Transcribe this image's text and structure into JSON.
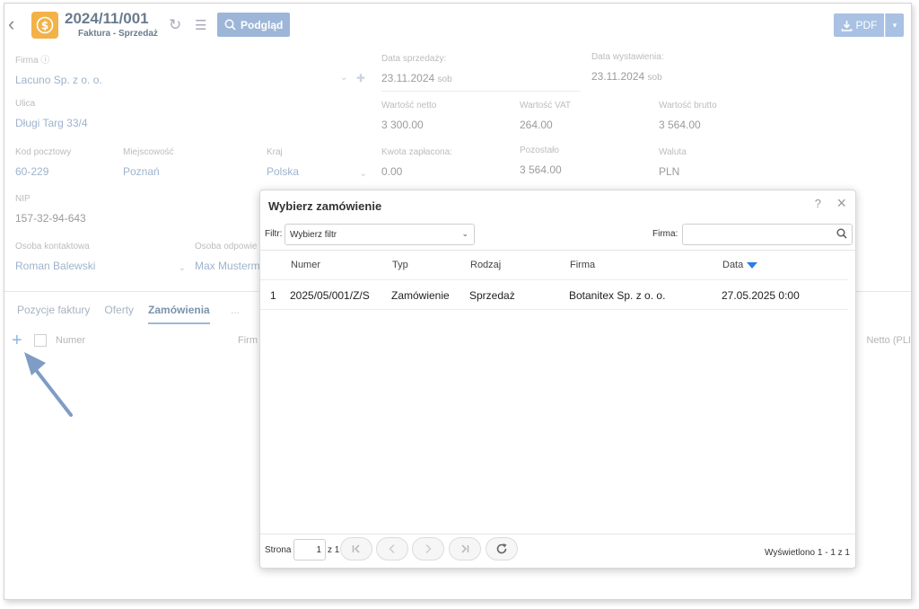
{
  "header": {
    "doc_number": "2024/11/001",
    "doc_subtitle": "Faktura - Sprzedaż",
    "preview_label": "Podgląd",
    "pdf_label": "PDF"
  },
  "form": {
    "firma": {
      "label": "Firma",
      "value": "Lacuno Sp. z o. o."
    },
    "data_sprzedazy": {
      "label": "Data sprzedaży:",
      "value": "23.11.2024",
      "day": "sob"
    },
    "data_wystawienia": {
      "label": "Data wystawienia:",
      "value": "23.11.2024",
      "day": "sob"
    },
    "ulica": {
      "label": "Ulica",
      "value": "Długi Targ 33/4"
    },
    "wartosc_netto": {
      "label": "Wartość netto",
      "value": "3 300.00"
    },
    "wartosc_vat": {
      "label": "Wartość VAT",
      "value": "264.00"
    },
    "wartosc_brutto": {
      "label": "Wartość brutto",
      "value": "3 564.00"
    },
    "kod_pocztowy": {
      "label": "Kod pocztowy",
      "value": "60-229"
    },
    "miejscowosc": {
      "label": "Miejscowość",
      "value": "Poznań"
    },
    "kraj": {
      "label": "Kraj",
      "value": "Polska"
    },
    "kwota_zaplacona": {
      "label": "Kwota zapłacona:",
      "value": "0.00"
    },
    "pozostalo": {
      "label": "Pozostało",
      "value": "3 564.00"
    },
    "waluta": {
      "label": "Waluta",
      "value": "PLN"
    },
    "nip": {
      "label": "NIP",
      "value": "157-32-94-643"
    },
    "osoba_kontaktowa": {
      "label": "Osoba kontaktowa",
      "value": "Roman Balewski"
    },
    "osoba_odpowiedzialna": {
      "label": "Osoba odpowie",
      "value": "Max Musterm"
    }
  },
  "tabs": [
    {
      "label": "Pozycje faktury"
    },
    {
      "label": "Oferty"
    },
    {
      "label": "Zamówienia"
    }
  ],
  "tab_more": "...",
  "list_headers": {
    "numer": "Numer",
    "firma": "Firm",
    "netto": "Netto (PLI"
  },
  "modal": {
    "title": "Wybierz zamówienie",
    "help": "?",
    "filter_label": "Filtr:",
    "filter_value": "Wybierz filtr",
    "firma_label": "Firma:",
    "columns": {
      "numer": "Numer",
      "typ": "Typ",
      "rodzaj": "Rodzaj",
      "firma": "Firma",
      "data": "Data"
    },
    "rows": [
      {
        "idx": "1",
        "numer": "2025/05/001/Z/S",
        "typ": "Zamówienie",
        "rodzaj": "Sprzedaż",
        "firma": "Botanitex Sp. z o. o.",
        "data": "27.05.2025 0:00"
      }
    ],
    "pager": {
      "page_label": "Strona",
      "page": "1",
      "of_label": "z 1",
      "info": "Wyświetlono 1 - 1 z 1"
    }
  }
}
